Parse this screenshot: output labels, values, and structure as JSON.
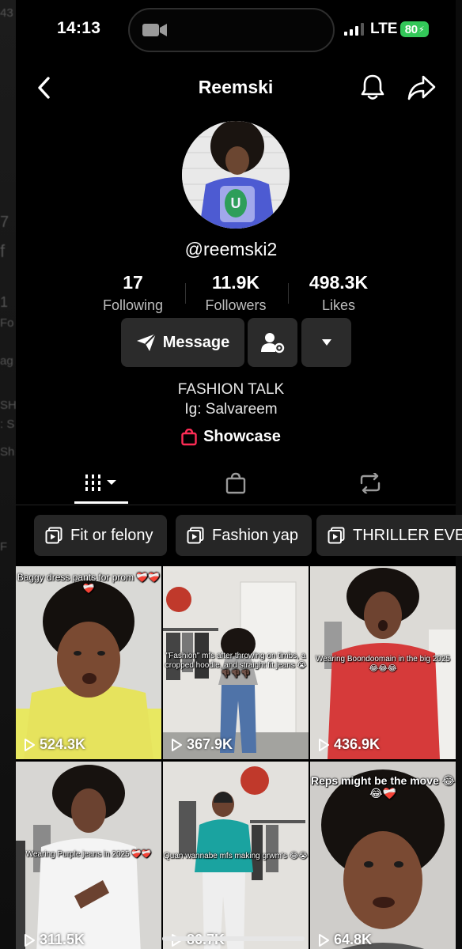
{
  "status": {
    "time": "14:13",
    "network": "LTE",
    "battery": "80"
  },
  "header": {
    "title": "Reemski"
  },
  "profile": {
    "handle": "@reemski2",
    "stats": [
      {
        "value": "17",
        "label": "Following"
      },
      {
        "value": "11.9K",
        "label": "Followers"
      },
      {
        "value": "498.3K",
        "label": "Likes"
      }
    ],
    "message_label": "Message",
    "bio_line1": "FASHION TALK",
    "bio_line2": "Ig: Salvareem",
    "showcase_label": "Showcase"
  },
  "playlists": [
    "Fit or felony",
    "Fashion yap",
    "THRILLER EVE"
  ],
  "videos": [
    {
      "caption": "Baggy dress pants for prom ❤️‍🩹❤️‍🩹❤️‍🩹",
      "views": "524.3K"
    },
    {
      "caption": "\"Fashion\" mfs after throwing on timbs, a cropped hoodie, and straight fit jeans 😭👎🏿👎🏿👎🏿",
      "views": "367.9K"
    },
    {
      "caption": "Wearing Boondoomain in the big 2025 😂😂😂",
      "views": "436.9K"
    },
    {
      "caption": "Wearing Purple jeans in 2025 ❤️‍🩹❤️‍🩹",
      "views": "311.5K"
    },
    {
      "caption": "Quan wannabe mfs making grwm's 😂😭",
      "views": "86.7K"
    },
    {
      "caption": "Reps might be the move 😂😂❤️‍🩹",
      "views": "64.8K"
    }
  ],
  "colors": {
    "accent_battery": "#33c759",
    "showcase_icon": "#fe2c55",
    "button_bg": "#2b2b2b"
  },
  "icons": [
    "back-icon",
    "bell-icon",
    "share-icon",
    "message-icon",
    "friend-settings-icon",
    "chevron-down-icon",
    "grid-icon",
    "bag-icon",
    "repost-icon",
    "playlist-icon",
    "play-icon"
  ]
}
